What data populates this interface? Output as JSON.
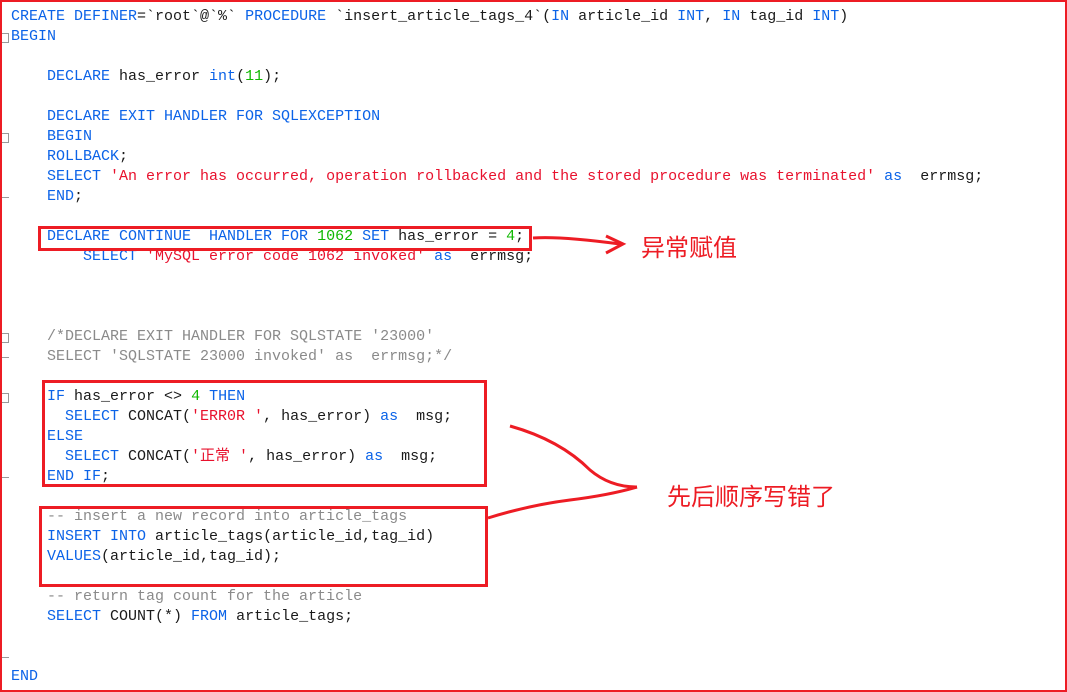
{
  "editor": {
    "lines": [
      [
        [
          "kw",
          "CREATE DEFINER"
        ],
        [
          "id",
          "=`root`@`%` "
        ],
        [
          "kw",
          "PROCEDURE "
        ],
        [
          "id",
          "`insert_article_tags_4`("
        ],
        [
          "kw",
          "IN "
        ],
        [
          "id",
          "article_id "
        ],
        [
          "kw",
          "INT"
        ],
        [
          "id",
          ", "
        ],
        [
          "kw",
          "IN "
        ],
        [
          "id",
          "tag_id "
        ],
        [
          "kw",
          "INT"
        ],
        [
          "id",
          ")"
        ]
      ],
      [
        [
          "kw",
          "BEGIN"
        ]
      ],
      [],
      [
        [
          "id",
          "    "
        ],
        [
          "kw",
          "DECLARE "
        ],
        [
          "id",
          "has_error "
        ],
        [
          "kw",
          "int"
        ],
        [
          "id",
          "("
        ],
        [
          "num",
          "11"
        ],
        [
          "id",
          ");"
        ]
      ],
      [],
      [
        [
          "id",
          "    "
        ],
        [
          "kw",
          "DECLARE EXIT HANDLER FOR SQLEXCEPTION"
        ]
      ],
      [
        [
          "id",
          "    "
        ],
        [
          "kw",
          "BEGIN"
        ]
      ],
      [
        [
          "id",
          "    "
        ],
        [
          "kw",
          "ROLLBACK"
        ],
        [
          "id",
          ";"
        ]
      ],
      [
        [
          "id",
          "    "
        ],
        [
          "kw",
          "SELECT "
        ],
        [
          "str",
          "'An error has occurred, operation rollbacked and the stored procedure was terminated'"
        ],
        [
          "id",
          " "
        ],
        [
          "kw",
          "as"
        ],
        [
          "id",
          "  errmsg;"
        ]
      ],
      [
        [
          "id",
          "    "
        ],
        [
          "kw",
          "END"
        ],
        [
          "id",
          ";"
        ]
      ],
      [],
      [
        [
          "id",
          "    "
        ],
        [
          "kw",
          "DECLARE CONTINUE  HANDLER FOR "
        ],
        [
          "num",
          "1062"
        ],
        [
          "kw",
          " SET "
        ],
        [
          "id",
          "has_error = "
        ],
        [
          "num",
          "4"
        ],
        [
          "id",
          ";"
        ]
      ],
      [
        [
          "id",
          "        "
        ],
        [
          "kw",
          "SELECT "
        ],
        [
          "str",
          "'MySQL error code 1062 invoked'"
        ],
        [
          "id",
          " "
        ],
        [
          "kw",
          "as"
        ],
        [
          "id",
          "  errmsg;"
        ]
      ],
      [],
      [],
      [],
      [
        [
          "id",
          "    "
        ],
        [
          "cm",
          "/*DECLARE EXIT HANDLER FOR SQLSTATE '23000'"
        ]
      ],
      [
        [
          "id",
          "    "
        ],
        [
          "cm",
          "SELECT 'SQLSTATE 23000 invoked' as  errmsg;*/"
        ]
      ],
      [],
      [
        [
          "id",
          "    "
        ],
        [
          "kw",
          "IF "
        ],
        [
          "id",
          "has_error <> "
        ],
        [
          "num",
          "4"
        ],
        [
          "kw",
          " THEN"
        ]
      ],
      [
        [
          "id",
          "      "
        ],
        [
          "kw",
          "SELECT "
        ],
        [
          "id",
          "CONCAT("
        ],
        [
          "str",
          "'ERR0R '"
        ],
        [
          "id",
          ", has_error) "
        ],
        [
          "kw",
          "as"
        ],
        [
          "id",
          "  msg;"
        ]
      ],
      [
        [
          "id",
          "    "
        ],
        [
          "kw",
          "ELSE"
        ]
      ],
      [
        [
          "id",
          "      "
        ],
        [
          "kw",
          "SELECT "
        ],
        [
          "id",
          "CONCAT("
        ],
        [
          "str",
          "'正常 '"
        ],
        [
          "id",
          ", has_error) "
        ],
        [
          "kw",
          "as"
        ],
        [
          "id",
          "  msg;"
        ]
      ],
      [
        [
          "id",
          "    "
        ],
        [
          "kw",
          "END IF"
        ],
        [
          "id",
          ";"
        ]
      ],
      [],
      [
        [
          "id",
          "    "
        ],
        [
          "cm",
          "-- insert a new record into article_tags"
        ]
      ],
      [
        [
          "id",
          "    "
        ],
        [
          "kw",
          "INSERT INTO "
        ],
        [
          "id",
          "article_tags(article_id,tag_id)"
        ]
      ],
      [
        [
          "id",
          "    "
        ],
        [
          "kw",
          "VALUES"
        ],
        [
          "id",
          "(article_id,tag_id);"
        ]
      ],
      [],
      [
        [
          "id",
          "    "
        ],
        [
          "cm",
          "-- return tag count for the article"
        ]
      ],
      [
        [
          "id",
          "    "
        ],
        [
          "kw",
          "SELECT "
        ],
        [
          "id",
          "COUNT(*) "
        ],
        [
          "kw",
          "FROM "
        ],
        [
          "id",
          "article_tags;"
        ]
      ],
      [],
      [],
      [
        [
          "kw",
          "END"
        ]
      ]
    ]
  },
  "annotations": {
    "note1": "异常赋值",
    "note2": "先后顺序写错了"
  },
  "colors": {
    "keyword": "#0b63e8",
    "string": "#e8112d",
    "number": "#0fb800",
    "comment": "#8a8a8a",
    "annotation": "#ed1c24"
  }
}
